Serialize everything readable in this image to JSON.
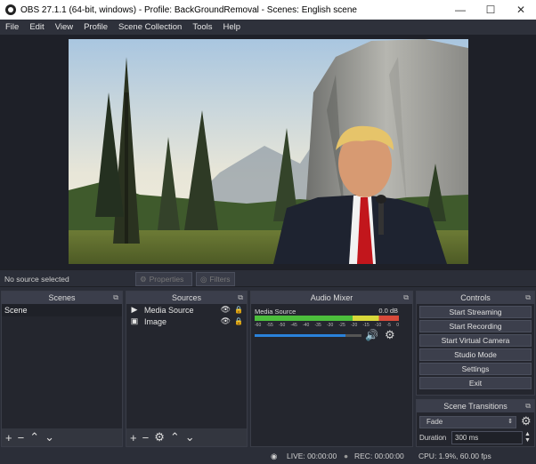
{
  "window": {
    "title": "OBS 27.1.1 (64-bit, windows) - Profile: BackGroundRemoval - Scenes: English scene"
  },
  "menu": [
    "File",
    "Edit",
    "View",
    "Profile",
    "Scene Collection",
    "Tools",
    "Help"
  ],
  "preview": {
    "image": "mountain-valley-with-person-overlay"
  },
  "source_toolbar": {
    "status": "No source selected",
    "properties": "Properties",
    "filters": "Filters"
  },
  "scenes": {
    "title": "Scenes",
    "items": [
      "Scene"
    ]
  },
  "sources": {
    "title": "Sources",
    "items": [
      {
        "name": "Media Source",
        "icon": "play-icon"
      },
      {
        "name": "Image",
        "icon": "image-icon"
      }
    ]
  },
  "mixer": {
    "title": "Audio Mixer",
    "track": "Media Source",
    "level": "0.0 dB",
    "scale": [
      "-60",
      "-55",
      "-50",
      "-45",
      "-40",
      "-35",
      "-30",
      "-25",
      "-20",
      "-15",
      "-10",
      "-5",
      "0"
    ],
    "volume": 0.85
  },
  "controls": {
    "title": "Controls",
    "buttons": [
      "Start Streaming",
      "Start Recording",
      "Start Virtual Camera",
      "Studio Mode",
      "Settings",
      "Exit"
    ]
  },
  "transitions": {
    "title": "Scene Transitions",
    "selected": "Fade",
    "duration_label": "Duration",
    "duration": "300 ms"
  },
  "status": {
    "live": "LIVE: 00:00:00",
    "rec": "REC: 00:00:00",
    "cpu": "CPU: 1.9%, 60.00 fps"
  },
  "colors": {
    "accent": "#2a82da",
    "meter_green": "#4cbe3c",
    "meter_yellow": "#d8d83a",
    "meter_red": "#d84a3a"
  }
}
